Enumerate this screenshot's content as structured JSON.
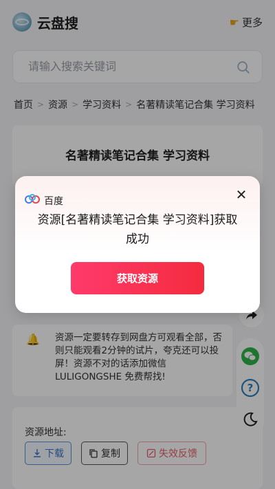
{
  "header": {
    "title": "云盘搜",
    "more_label": "更多"
  },
  "search": {
    "placeholder": "请输入搜索关键词"
  },
  "breadcrumb": [
    "首页",
    "资源",
    "学习资料",
    "名著精读笔记合集 学习资料"
  ],
  "resource": {
    "title": "名著精读笔记合集 学习资料"
  },
  "notice": {
    "text": "资源一定要转存到网盘方可观看全部，否则只能观看2分钟的试片，夸克还可以投屏！资源不对的话添加微信 LULIGONGSHE 免费帮找!"
  },
  "address": {
    "label": "资源地址:",
    "download_label": "下载",
    "copy_label": "复制",
    "report_label": "失效反馈"
  },
  "modal": {
    "source_label": "百度",
    "message": "资源[名著精读笔记合集 学习资料]获取成功",
    "button_label": "获取资源"
  },
  "colors": {
    "accent": "#f42b3e",
    "link_blue": "#3a74c4",
    "wechat_green": "#2db44a",
    "help_blue": "#2d7fc1"
  },
  "icons": [
    "search-icon",
    "hand-pointing-icon",
    "bell-icon",
    "share-icon",
    "wechat-icon",
    "help-icon",
    "moon-icon",
    "close-icon",
    "download-icon",
    "copy-icon",
    "report-icon",
    "baidu-logo"
  ]
}
